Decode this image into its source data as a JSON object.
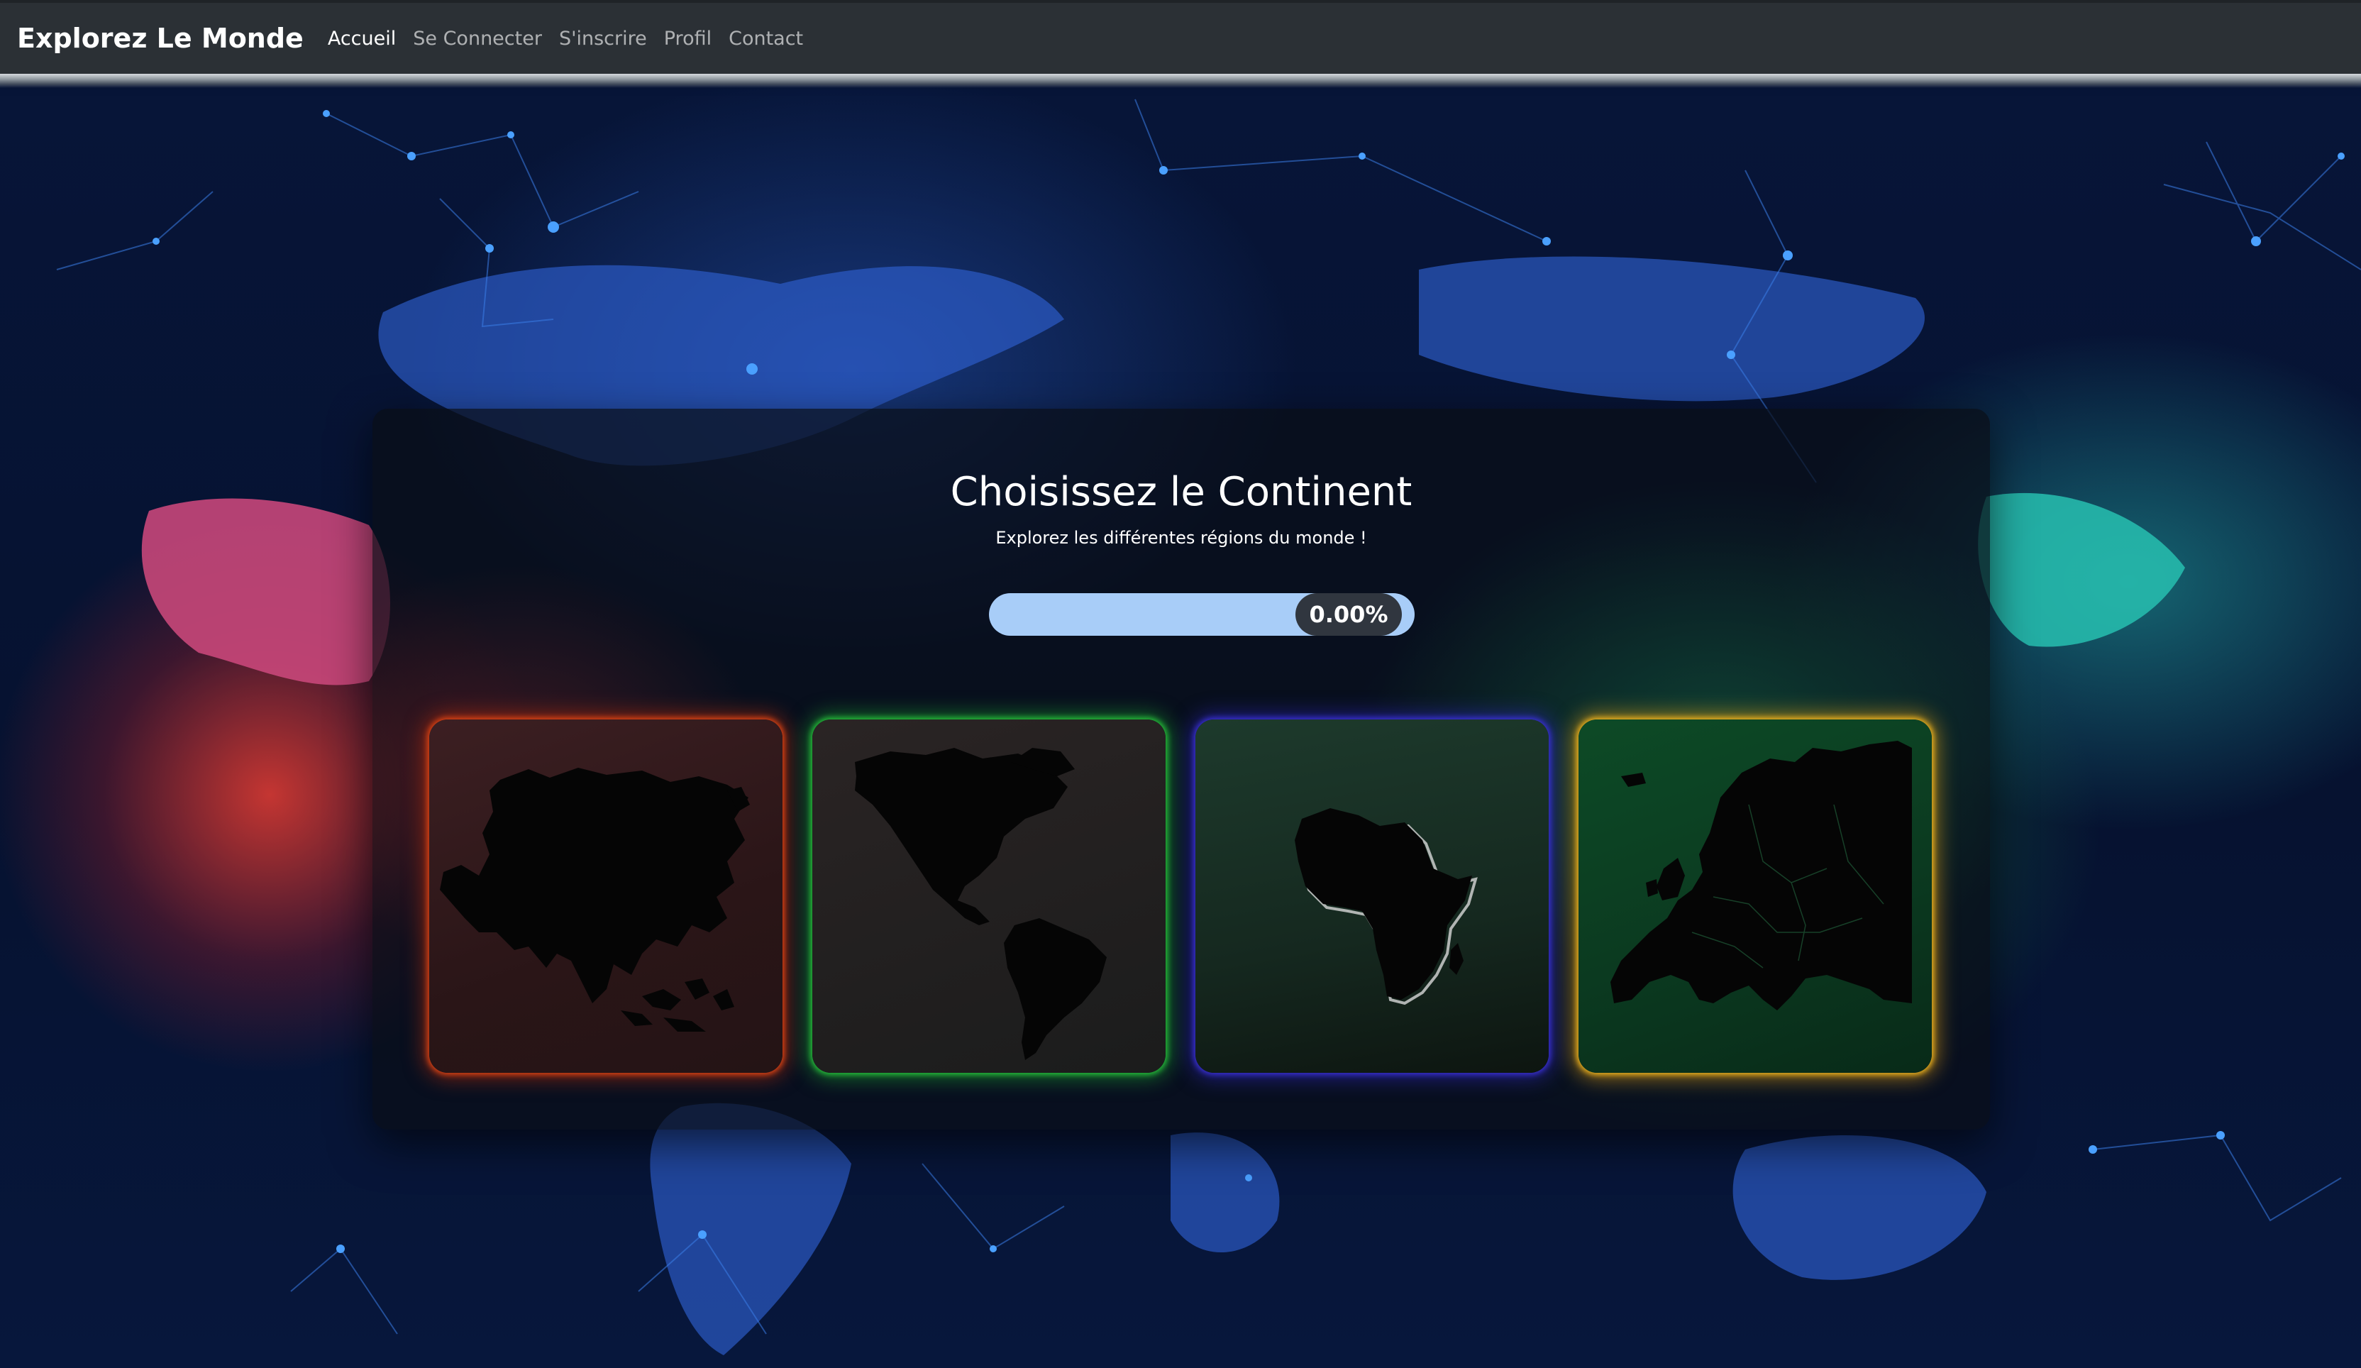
{
  "navbar": {
    "brand": "Explorez Le Monde",
    "links": [
      {
        "label": "Accueil",
        "active": true
      },
      {
        "label": "Se Connecter",
        "active": false
      },
      {
        "label": "S'inscrire",
        "active": false
      },
      {
        "label": "Profil",
        "active": false
      },
      {
        "label": "Contact",
        "active": false
      }
    ]
  },
  "main": {
    "title": "Choisissez le Continent",
    "subtitle": "Explorez les différentes régions du monde !",
    "progress": {
      "value": 0.0,
      "label": "0.00%"
    },
    "continents": [
      {
        "name": "asia-tile",
        "glow_color": "#e6461a"
      },
      {
        "name": "americas-tile",
        "glow_color": "#28c83c"
      },
      {
        "name": "africa-tile",
        "glow_color": "#3c32dc"
      },
      {
        "name": "europe-tile",
        "glow_color": "#f0b41e"
      }
    ]
  },
  "colors": {
    "navbar_bg": "#2b3035",
    "progress_bar": "#a8cdf8",
    "progress_label_bg": "#30363f"
  }
}
